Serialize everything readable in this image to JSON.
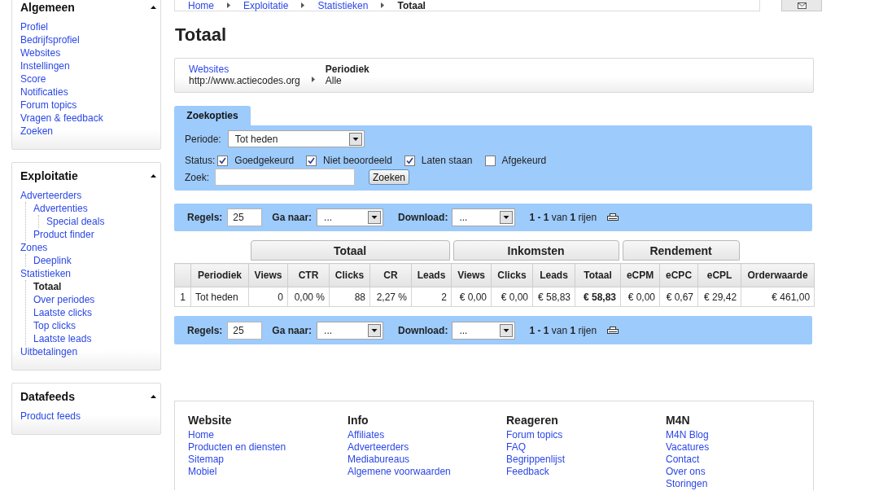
{
  "breadcrumb": {
    "items": [
      {
        "label": "Home",
        "current": false
      },
      {
        "label": "Exploitatie",
        "current": false
      },
      {
        "label": "Statistieken",
        "current": false
      },
      {
        "label": "Totaal",
        "current": true
      }
    ]
  },
  "sidebar": {
    "sections": [
      {
        "title": "Algemeen",
        "expanded": true,
        "items": [
          {
            "label": "Profiel",
            "selected": false
          },
          {
            "label": "Bedrijfsprofiel",
            "selected": false
          },
          {
            "label": "Websites",
            "selected": false
          },
          {
            "label": "Instellingen",
            "selected": false
          },
          {
            "label": "Score",
            "selected": false
          },
          {
            "label": "Notificaties",
            "selected": false
          },
          {
            "label": "Forum topics",
            "selected": false
          },
          {
            "label": "Vragen & feedback",
            "selected": false
          },
          {
            "label": "Zoeken",
            "selected": false
          }
        ]
      },
      {
        "title": "Exploitatie",
        "expanded": true,
        "items": [
          {
            "label": "Adverteerders",
            "selected": false,
            "children": [
              {
                "label": "Advertenties",
                "selected": false,
                "children": [
                  {
                    "label": "Special deals",
                    "selected": false
                  }
                ]
              },
              {
                "label": "Product finder",
                "selected": false
              }
            ]
          },
          {
            "label": "Zones",
            "selected": false,
            "children": [
              {
                "label": "Deeplink",
                "selected": false
              }
            ]
          },
          {
            "label": "Statistieken",
            "selected": false,
            "children": [
              {
                "label": "Totaal",
                "selected": true
              },
              {
                "label": "Over periodes",
                "selected": false
              },
              {
                "label": "Laatste clicks",
                "selected": false
              },
              {
                "label": "Top clicks",
                "selected": false
              },
              {
                "label": "Laatste leads",
                "selected": false
              }
            ]
          },
          {
            "label": "Uitbetalingen",
            "selected": false
          }
        ]
      },
      {
        "title": "Datafeeds",
        "expanded": true,
        "items": [
          {
            "label": "Product feeds",
            "selected": false
          }
        ]
      }
    ]
  },
  "page_title": "Totaal",
  "filter_summary": {
    "items": [
      {
        "kind": "link",
        "label": "Websites",
        "value": "http://www.actiecodes.org"
      },
      {
        "kind": "heading",
        "label": "Periodiek",
        "value": "Alle"
      }
    ]
  },
  "search_options": {
    "tab": "Zoekopties",
    "period": {
      "label": "Periode:",
      "value": "Tot heden"
    },
    "status": {
      "label": "Status:",
      "options": [
        {
          "label": "Goedgekeurd",
          "checked": true
        },
        {
          "label": "Niet beoordeeld",
          "checked": true
        },
        {
          "label": "Laten staan",
          "checked": true
        },
        {
          "label": "Afgekeurd",
          "checked": false
        }
      ]
    },
    "query": {
      "label": "Zoek:"
    },
    "button": "Zoeken"
  },
  "pagers": [
    {
      "rows_label": "Regels:",
      "rows_value": "25",
      "goto_label": "Ga naar:",
      "goto_value": "...",
      "download_label": "Download:",
      "download_value": "...",
      "summary": "**1 - 1** van **1** rijen"
    },
    {
      "rows_label": "Regels:",
      "rows_value": "25",
      "goto_label": "Ga naar:",
      "goto_value": "...",
      "download_label": "Download:",
      "download_value": "...",
      "summary": "**1 - 1** van **1** rijen"
    }
  ],
  "table": {
    "column_groups": [
      {
        "columns": [
          {
            "label": "Periodiek",
            "emphasized": false
          }
        ]
      },
      {
        "label": "Totaal",
        "columns": [
          {
            "label": "Views",
            "emphasized": false
          },
          {
            "label": "CTR",
            "emphasized": false
          },
          {
            "label": "Clicks",
            "emphasized": false
          },
          {
            "label": "CR",
            "emphasized": false
          },
          {
            "label": "Leads",
            "emphasized": false
          }
        ]
      },
      {
        "label": "Inkomsten",
        "columns": [
          {
            "label": "Views",
            "emphasized": false
          },
          {
            "label": "Clicks",
            "emphasized": false
          },
          {
            "label": "Leads",
            "emphasized": false
          },
          {
            "label": "Totaal",
            "emphasized": true
          }
        ]
      },
      {
        "label": "Rendement",
        "columns": [
          {
            "label": "eCPM",
            "emphasized": false
          },
          {
            "label": "eCPC",
            "emphasized": false
          },
          {
            "label": "eCPL",
            "emphasized": false
          }
        ]
      },
      {
        "columns": [
          {
            "label": "Orderwaarde",
            "emphasized": false
          }
        ]
      }
    ],
    "rows": [
      {
        "number": "1",
        "cells": [
          "Tot heden",
          "0",
          "0,00 %",
          "88",
          "2,27 %",
          "2",
          "€ 0,00",
          "€ 0,00",
          "€ 58,83",
          "€ 58,83",
          "€ 0,00",
          "€ 0,67",
          "€ 29,42",
          "€ 461,00"
        ]
      }
    ]
  },
  "footer": {
    "columns": [
      {
        "title": "Website",
        "links": [
          "Home",
          "Producten en diensten",
          "Sitemap",
          "Mobiel"
        ]
      },
      {
        "title": "Info",
        "links": [
          "Affiliates",
          "Adverteerders",
          "Mediabureaus",
          "Algemene voorwaarden"
        ]
      },
      {
        "title": "Reageren",
        "links": [
          "Forum topics",
          "FAQ",
          "Begrippenlijst",
          "Feedback"
        ]
      },
      {
        "title": "M4N",
        "links": [
          "M4N Blog",
          "Vacatures",
          "Contact",
          "Over ons",
          "Storingen"
        ]
      }
    ]
  }
}
